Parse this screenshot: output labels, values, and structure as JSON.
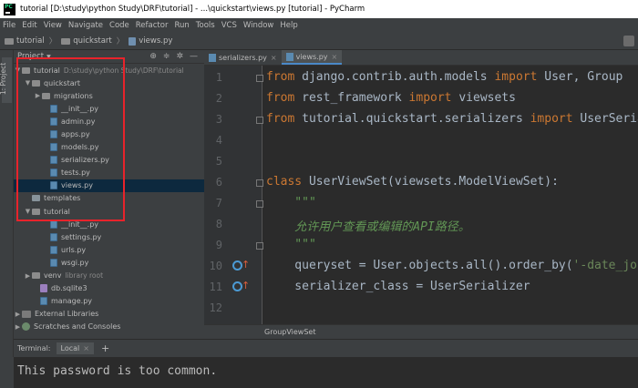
{
  "window": {
    "title": "tutorial [D:\\study\\python Study\\DRF\\tutorial] - ...\\quickstart\\views.py [tutorial] - PyCharm"
  },
  "menu": [
    "File",
    "Edit",
    "View",
    "Navigate",
    "Code",
    "Refactor",
    "Run",
    "Tools",
    "VCS",
    "Window",
    "Help"
  ],
  "breadcrumbs": [
    "tutorial",
    "quickstart",
    "views.py"
  ],
  "side_tab": "1: Project",
  "project_panel": {
    "title": "Project"
  },
  "tree": [
    {
      "label": "tutorial",
      "sub": "D:\\study\\python Study\\DRF\\tutorial"
    },
    {
      "label": "quickstart"
    },
    {
      "label": "migrations"
    },
    {
      "label": "__init__.py"
    },
    {
      "label": "admin.py"
    },
    {
      "label": "apps.py"
    },
    {
      "label": "models.py"
    },
    {
      "label": "serializers.py"
    },
    {
      "label": "tests.py"
    },
    {
      "label": "views.py"
    },
    {
      "label": "templates"
    },
    {
      "label": "tutorial"
    },
    {
      "label": "__init__.py"
    },
    {
      "label": "settings.py"
    },
    {
      "label": "urls.py"
    },
    {
      "label": "wsgi.py"
    },
    {
      "label": "venv",
      "sub": "library root"
    },
    {
      "label": "db.sqlite3"
    },
    {
      "label": "manage.py"
    },
    {
      "label": "External Libraries"
    },
    {
      "label": "Scratches and Consoles"
    }
  ],
  "editor_tabs": [
    "serializers.py",
    "views.py"
  ],
  "line_numbers": [
    "1",
    "2",
    "3",
    "4",
    "5",
    "6",
    "7",
    "8",
    "9",
    "10",
    "11",
    "12"
  ],
  "code": {
    "l1": {
      "kw1": "from",
      "mod": " django.contrib.auth.models ",
      "kw2": "import",
      "rest": " User, Group"
    },
    "l2": {
      "kw1": "from",
      "mod": " rest_framework ",
      "kw2": "import",
      "rest": " viewsets"
    },
    "l3": {
      "kw1": "from",
      "mod": " tutorial.quickstart.serializers ",
      "kw2": "import",
      "rest": " UserSerial"
    },
    "l6": {
      "kw": "class",
      "rest": " UserViewSet(viewsets.ModelViewSet):"
    },
    "l7": "    \"\"\"",
    "l8": "    允许用户查看或编辑的API路径。",
    "l9": "    \"\"\"",
    "l10": {
      "a": "    queryset = User.objects.all().order_by(",
      "s": "'-date_joi"
    },
    "l11": "    serializer_class = UserSerializer"
  },
  "editor_breadcrumb": "GroupViewSet",
  "terminal": {
    "label": "Terminal:",
    "tab": "Local",
    "output": "This password is too common."
  }
}
